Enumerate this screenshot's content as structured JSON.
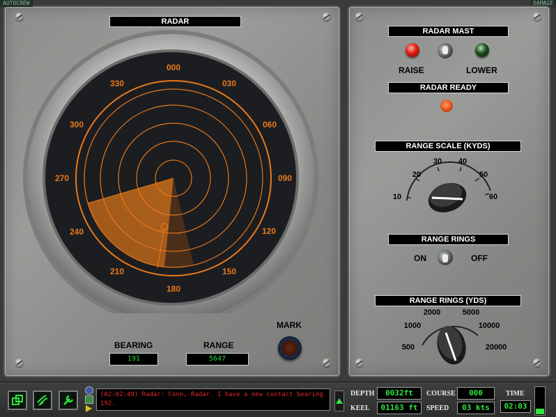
{
  "corner_tabs": {
    "autocrew": "AUTOCREW",
    "damage": "DAMAGE"
  },
  "radar": {
    "title": "RADAR",
    "bearings": [
      "000",
      "030",
      "060",
      "090",
      "120",
      "150",
      "180",
      "210",
      "240",
      "270",
      "300",
      "330"
    ],
    "bearing_label": "BEARING",
    "bearing_value": "191",
    "range_label": "RANGE",
    "range_value": "5647",
    "mark_label": "MARK"
  },
  "controls": {
    "mast_title": "RADAR MAST",
    "raise_label": "RAISE",
    "lower_label": "LOWER",
    "ready_title": "RADAR READY",
    "range_scale_title": "RANGE SCALE (KYDS)",
    "range_scale_ticks": [
      "10",
      "20",
      "30",
      "40",
      "50",
      "60"
    ],
    "range_rings_title": "RANGE RINGS",
    "on_label": "ON",
    "off_label": "OFF",
    "range_rings_yds_title": "RANGE RINGS (YDS)",
    "range_rings_yds_ticks": [
      "500",
      "1000",
      "2000",
      "5000",
      "10000",
      "20000"
    ]
  },
  "colors": {
    "scope_orange": "#e8781a",
    "lcd_green": "#29d93c",
    "message_red": "#e32a2a"
  },
  "bottom": {
    "message": "(02:02:49) Radar: Conn, Radar. I have a new contact bearing 192.",
    "depth_label": "DEPTH",
    "depth_value": "0032ft",
    "keel_label": "KEEL",
    "keel_value": "01163 ft",
    "course_label": "COURSE",
    "course_value": "000",
    "speed_label": "SPEED",
    "speed_value": "03 kts",
    "time_label": "TIME",
    "time_value": "02:03"
  }
}
